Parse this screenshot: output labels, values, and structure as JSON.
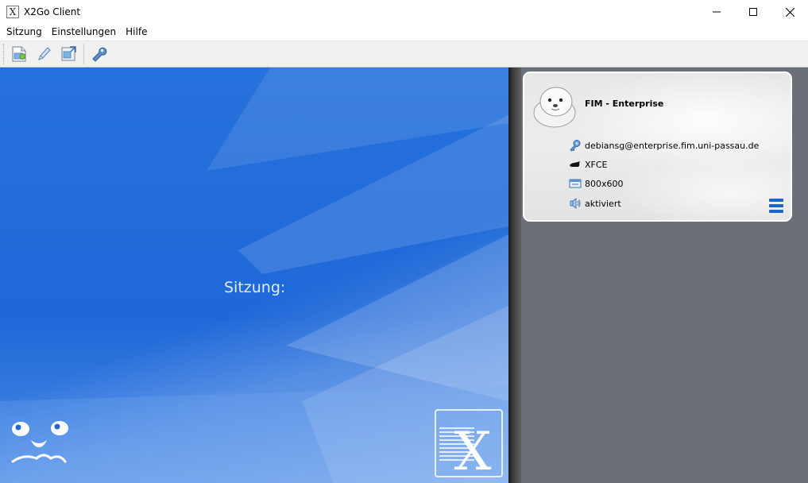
{
  "window": {
    "title": "X2Go Client",
    "app_icon_glyph": "X",
    "controls": [
      "minimize-icon",
      "maximize-icon",
      "close-icon"
    ]
  },
  "menubar": {
    "items": [
      {
        "label": "Sitzung"
      },
      {
        "label": "Einstellungen"
      },
      {
        "label": "Hilfe"
      }
    ]
  },
  "toolbar": {
    "buttons": [
      {
        "icon": "new-session-icon"
      },
      {
        "icon": "edit-session-icon"
      },
      {
        "icon": "session-export-icon"
      },
      {
        "icon": "settings-wrench-icon"
      }
    ]
  },
  "main": {
    "session_label": "Sitzung:",
    "background_color": "#2672dc"
  },
  "session_card": {
    "name": "FIM - Enterprise",
    "server": "debiansg@enterprise.fim.uni-passau.de",
    "desktop": "XFCE",
    "resolution": "800x600",
    "sound": "aktiviert",
    "accent_color": "#1e63c8"
  }
}
